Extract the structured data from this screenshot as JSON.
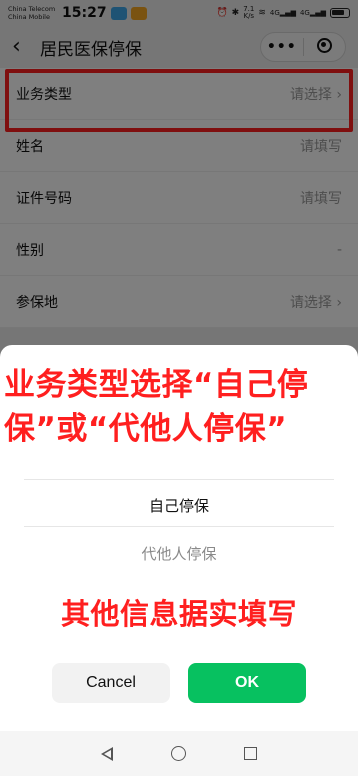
{
  "status_bar": {
    "carrier_1": "China Telecom",
    "carrier_2": "China Mobile",
    "time": "15:27",
    "network_speed_value": "7.1",
    "network_speed_unit": "K/s",
    "signal_1": "4G",
    "signal_2": "4G"
  },
  "nav": {
    "title": "居民医保停保"
  },
  "form": {
    "rows": [
      {
        "label": "业务类型",
        "value": "请选择 ›"
      },
      {
        "label": "姓名",
        "value": "请填写"
      },
      {
        "label": "证件号码",
        "value": "请填写"
      },
      {
        "label": "性别",
        "value": "-"
      },
      {
        "label": "参保地",
        "value": "请选择 ›"
      }
    ]
  },
  "sheet": {
    "annotation_top": "业务类型选择“自己停保”或“代他人停保”",
    "options": [
      "自己停保",
      "代他人停保"
    ],
    "annotation_bottom": "其他信息据实填写",
    "cancel_label": "Cancel",
    "ok_label": "OK"
  },
  "colors": {
    "accent_green": "#07c160",
    "annotation_red": "#ff1f1f",
    "highlight_red": "#ff1f1f"
  }
}
